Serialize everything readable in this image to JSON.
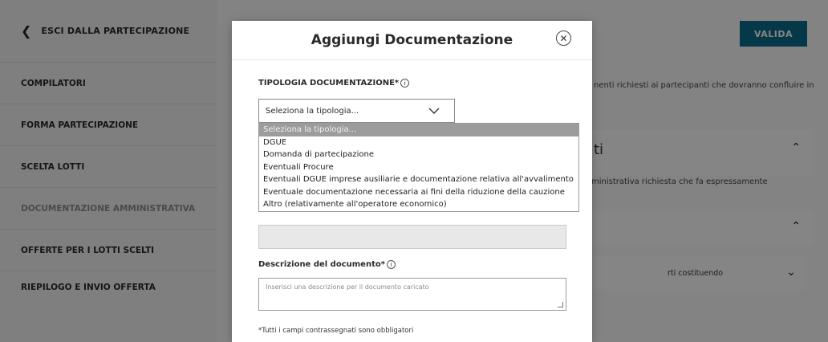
{
  "sidebar": {
    "back_label": "ESCI DALLA PARTECIPAZIONE",
    "items": [
      {
        "label": "COMPILATORI"
      },
      {
        "label": "FORMA PARTECIPAZIONE"
      },
      {
        "label": "SCELTA LOTTI"
      },
      {
        "label": "DOCUMENTAZIONE AMMINISTRATIVA"
      },
      {
        "label": "OFFERTE PER I LOTTI SCELTI"
      },
      {
        "label": "RIEPILOGO E INVIO OFFERTA"
      }
    ]
  },
  "main": {
    "valida_label": "VALIDA",
    "text_1": "nenti richiesti ai partecipanti che dovranno confluire in",
    "section_title": "ti",
    "text_2": "ministrativa richiesta che fa espressamente",
    "row_label": "rti costituendo"
  },
  "modal": {
    "title": "Aggiungi Documentazione",
    "tipologia_label": "TIPOLOGIA DOCUMENTAZIONE*",
    "select_value": "Seleziona la tipologia...",
    "options": [
      "Seleziona la tipologia...",
      "DGUE",
      "Domanda di partecipazione",
      "Eventuali Procure",
      "Eventuali DGUE imprese ausiliarie e documentazione relativa all'avvalimento",
      "Eventuale documentazione necessaria ai fini della riduzione della cauzione",
      "Altro (relativamente all'operatore economico)"
    ],
    "descrizione_label": "Descrizione del documento*",
    "descrizione_placeholder": "Inserisci una descrizione per il documento caricato",
    "footnote": "*Tutti i campi contrassegnati sono obbligatori"
  },
  "icons": {
    "back": "chevron-left-icon",
    "close": "close-circle-icon",
    "caret": "chevron-down-icon",
    "info": "info-icon"
  },
  "colors": {
    "accent": "#0a6b8a",
    "overlay": "#000000",
    "selected_option": "#9c9c9c"
  }
}
